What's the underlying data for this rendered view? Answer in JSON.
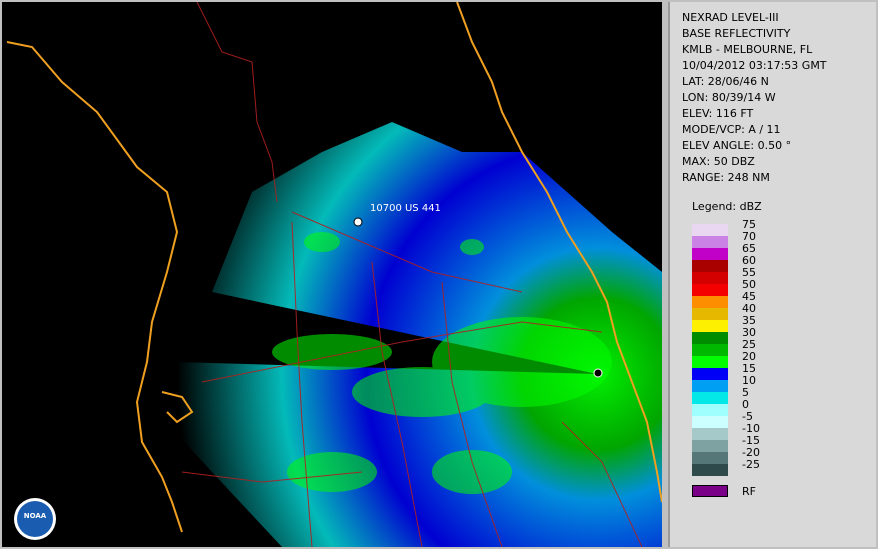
{
  "info": {
    "line1": "NEXRAD LEVEL-III",
    "line2": "BASE REFLECTIVITY",
    "line3": "KMLB - MELBOURNE, FL",
    "line4": "10/04/2012 03:17:53 GMT",
    "line5": "LAT: 28/06/46 N",
    "line6": "LON: 80/39/14 W",
    "line7": "ELEV: 116 FT",
    "line8": "MODE/VCP: A / 11",
    "line9": "ELEV ANGLE: 0.50 °",
    "line10": "MAX: 50 DBZ",
    "line11": "RANGE: 248 NM"
  },
  "legend": {
    "title": "Legend: dBZ",
    "entries": [
      {
        "label": "75",
        "color": "#e9d7f2"
      },
      {
        "label": "70",
        "color": "#ca83e4"
      },
      {
        "label": "65",
        "color": "#c100c8"
      },
      {
        "label": "60",
        "color": "#a90000"
      },
      {
        "label": "55",
        "color": "#d40000"
      },
      {
        "label": "50",
        "color": "#f40000"
      },
      {
        "label": "45",
        "color": "#fd8e00"
      },
      {
        "label": "40",
        "color": "#e7b800"
      },
      {
        "label": "35",
        "color": "#fdf000"
      },
      {
        "label": "30",
        "color": "#008c00"
      },
      {
        "label": "25",
        "color": "#01b800"
      },
      {
        "label": "20",
        "color": "#02fd02"
      },
      {
        "label": "15",
        "color": "#0000f6"
      },
      {
        "label": "10",
        "color": "#019ff4"
      },
      {
        "label": "5",
        "color": "#04e9e7"
      },
      {
        "label": "0",
        "color": "#9fffff"
      },
      {
        "label": "-5",
        "color": "#ccffff"
      },
      {
        "label": "-10",
        "color": "#a5c9c9"
      },
      {
        "label": "-15",
        "color": "#7ea1a1"
      },
      {
        "label": "-20",
        "color": "#567777"
      },
      {
        "label": "-25",
        "color": "#2e4a4a"
      }
    ],
    "rf_label": "RF",
    "rf_color": "#7b0088"
  },
  "map": {
    "marker_label": "10700 US 441",
    "logo_text": "NOAA"
  }
}
